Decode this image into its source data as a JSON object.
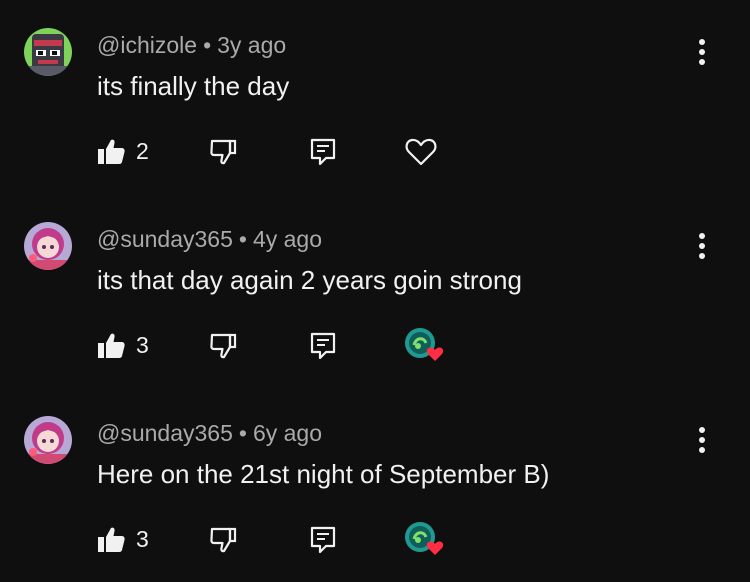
{
  "comments": [
    {
      "author": "@ichizole",
      "separator": "•",
      "time": "3y ago",
      "text": "its finally the day",
      "likes": "2",
      "creator_heart": false,
      "avatar_colors": {
        "bg": "#4a4a4a",
        "accent": "#c43a4a",
        "green": "#7fd35a"
      }
    },
    {
      "author": "@sunday365",
      "separator": "•",
      "time": "4y ago",
      "text": "its that day again 2 years goin strong",
      "likes": "3",
      "creator_heart": true,
      "avatar_colors": {
        "bg": "#b7a9d6",
        "accent": "#c03b8a",
        "green": "#ffffff"
      }
    },
    {
      "author": "@sunday365",
      "separator": "•",
      "time": "6y ago",
      "text": "Here on the 21st night of September B)",
      "likes": "3",
      "creator_heart": true,
      "avatar_colors": {
        "bg": "#b7a9d6",
        "accent": "#c03b8a",
        "green": "#ffffff"
      }
    }
  ],
  "icons": {
    "like": "thumbs-up-icon",
    "dislike": "thumbs-down-icon",
    "reply": "reply-icon",
    "heart": "heart-icon",
    "more": "more-vertical-icon",
    "creator_heart": "creator-heart-badge"
  },
  "colors": {
    "background": "#0f0f0f",
    "text_primary": "#f1f1f1",
    "text_secondary": "#aaaaaa",
    "heart_red": "#ff2e45",
    "badge_teal": "#1f9a92"
  }
}
